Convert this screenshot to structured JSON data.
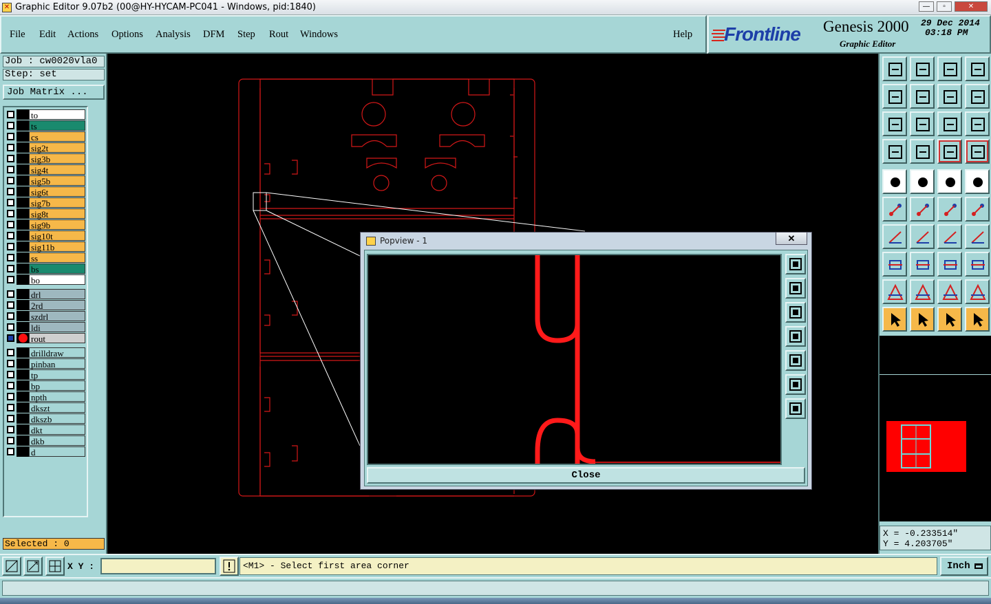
{
  "window": {
    "title": "Graphic Editor 9.07b2 (00@HY-HYCAM-PC041 - Windows, pid:1840)",
    "min": "—",
    "max": "▫",
    "close": "✕"
  },
  "menu": {
    "items": [
      "File",
      "Edit",
      "Actions",
      "Options",
      "Analysis",
      "DFM",
      "Step",
      "Rout",
      "Windows"
    ],
    "help": "Help"
  },
  "brand": {
    "logo": "Frontline",
    "product": "Genesis 2000",
    "subtitle": "Graphic Editor",
    "date": "29 Dec 2014",
    "time": "03:18 PM"
  },
  "job": {
    "job": "Job : cw0020vla0",
    "step": "Step: set",
    "matrix": "Job Matrix ..."
  },
  "layers": [
    {
      "name": "to",
      "color": "#ffffff"
    },
    {
      "name": "ts",
      "color": "#1a8a6e"
    },
    {
      "name": "cs",
      "color": "#f6b849"
    },
    {
      "name": "sig2t",
      "color": "#f6b849"
    },
    {
      "name": "sig3b",
      "color": "#f6b849"
    },
    {
      "name": "sig4t",
      "color": "#f6b849"
    },
    {
      "name": "sig5b",
      "color": "#f6b849"
    },
    {
      "name": "sig6t",
      "color": "#f6b849"
    },
    {
      "name": "sig7b",
      "color": "#f6b849"
    },
    {
      "name": "sig8t",
      "color": "#f6b849"
    },
    {
      "name": "sig9b",
      "color": "#f6b849"
    },
    {
      "name": "sig10t",
      "color": "#f6b849"
    },
    {
      "name": "sig11b",
      "color": "#f6b849"
    },
    {
      "name": "ss",
      "color": "#f6b849"
    },
    {
      "name": "bs",
      "color": "#1a8a6e"
    },
    {
      "name": "bo",
      "color": "#ffffff"
    },
    {
      "name": "drl",
      "color": "#9eb8bf"
    },
    {
      "name": "2rd",
      "color": "#9eb8bf"
    },
    {
      "name": "szdrl",
      "color": "#9eb8bf"
    },
    {
      "name": "ldi",
      "color": "#9eb8bf"
    },
    {
      "name": "rout",
      "color": "#cfcfcf",
      "active": true
    },
    {
      "name": "drilldraw",
      "color": "#a6d6d6"
    },
    {
      "name": "pinban",
      "color": "#a6d6d6"
    },
    {
      "name": "tp",
      "color": "#a6d6d6"
    },
    {
      "name": "bp",
      "color": "#a6d6d6"
    },
    {
      "name": "npth",
      "color": "#a6d6d6"
    },
    {
      "name": "dkszt",
      "color": "#a6d6d6"
    },
    {
      "name": "dkszb",
      "color": "#a6d6d6"
    },
    {
      "name": "dkt",
      "color": "#a6d6d6"
    },
    {
      "name": "dkb",
      "color": "#a6d6d6"
    },
    {
      "name": "d",
      "color": "#a6d6d6"
    }
  ],
  "selected": "Selected : 0",
  "popview": {
    "title": "Popview - 1",
    "close_x": "✕",
    "close_button": "Close"
  },
  "coords": {
    "x": "X = -0.233514\"",
    "y": "Y = 4.203705\""
  },
  "bottom": {
    "xy_label": "X Y :",
    "xy_value": "",
    "message": "<M1> - Select first area corner",
    "unit": "Inch"
  },
  "colors": {
    "panel": "#a6d6d6",
    "rout": "#ff0000",
    "canvas": "#000000"
  }
}
